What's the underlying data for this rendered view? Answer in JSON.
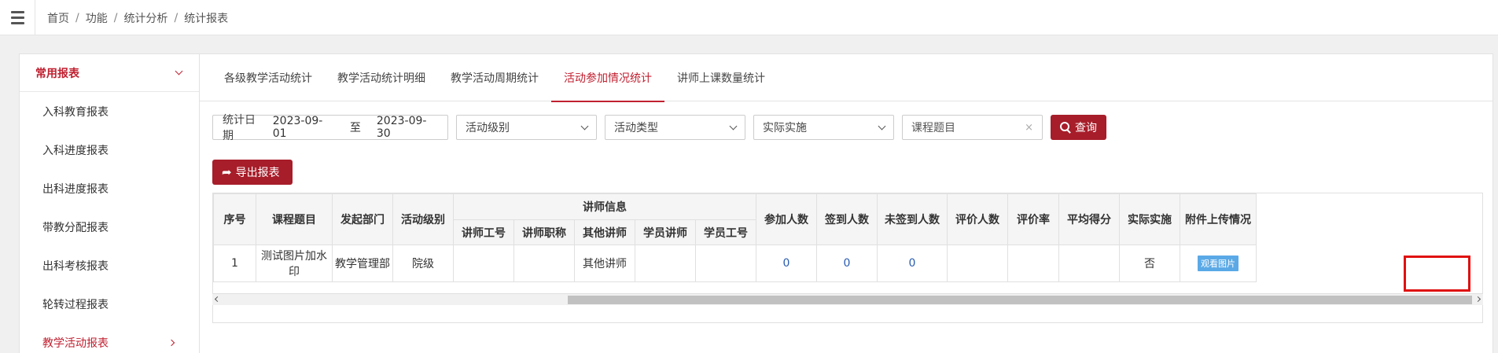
{
  "breadcrumb": [
    "首页",
    "功能",
    "统计分析",
    "统计报表"
  ],
  "sidebar": {
    "header": "常用报表",
    "items": [
      {
        "label": "入科教育报表"
      },
      {
        "label": "入科进度报表"
      },
      {
        "label": "出科进度报表"
      },
      {
        "label": "带教分配报表"
      },
      {
        "label": "出科考核报表"
      },
      {
        "label": "轮转过程报表"
      },
      {
        "label": "教学活动报表"
      }
    ]
  },
  "tabs": [
    "各级教学活动统计",
    "教学活动统计明细",
    "教学活动周期统计",
    "活动参加情况统计",
    "讲师上课数量统计"
  ],
  "active_tab": "活动参加情况统计",
  "filters": {
    "date_label": "统计日期",
    "date_from": "2023-09-01",
    "date_sep": "至",
    "date_to": "2023-09-30",
    "level_select": "活动级别",
    "type_select": "活动类型",
    "implement_select": "实际实施",
    "title_placeholder": "课程题目",
    "clear_icon": "×",
    "search_label": "查询"
  },
  "export_label": "导出报表",
  "table": {
    "headers": {
      "seq": "序号",
      "title": "课程题目",
      "dept": "发起部门",
      "level": "活动级别",
      "lecturer_group": "讲师信息",
      "lecturer_id": "讲师工号",
      "lecturer_title": "讲师职称",
      "other_lecturer": "其他讲师",
      "student_lecturer": "学员讲师",
      "student_id": "学员工号",
      "participants": "参加人数",
      "signed": "签到人数",
      "unsigned": "未签到人数",
      "evaluators": "评价人数",
      "eval_rate": "评价率",
      "avg_score": "平均得分",
      "implemented": "实际实施",
      "attachment": "附件上传情况"
    },
    "rows": [
      {
        "seq": "1",
        "title": "测试图片加水印",
        "dept": "教学管理部",
        "level": "院级",
        "lecturer_id": "",
        "lecturer_title": "",
        "other_lecturer": "其他讲师",
        "student_lecturer": "",
        "student_id": "",
        "participants": "0",
        "signed": "0",
        "unsigned": "0",
        "evaluators": "",
        "eval_rate": "",
        "avg_score": "",
        "implemented": "否",
        "attachment": "观看图片"
      }
    ]
  }
}
